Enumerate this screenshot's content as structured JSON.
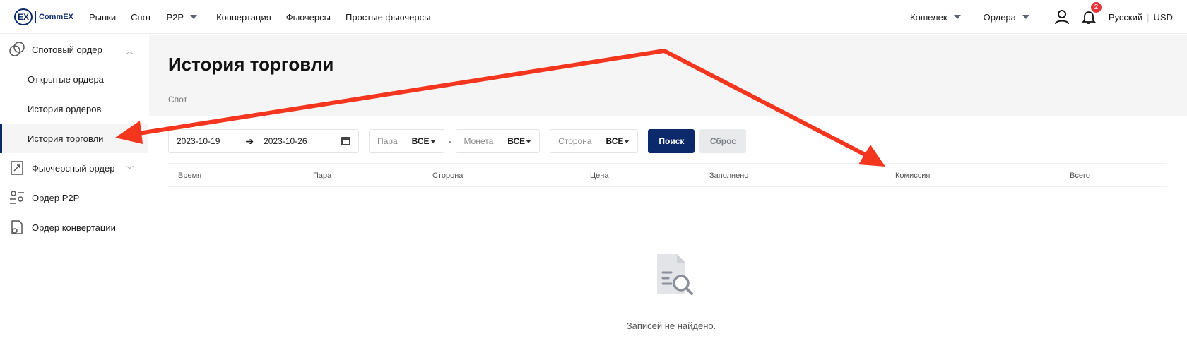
{
  "brand": {
    "mark": "EX",
    "name": "CommEX"
  },
  "nav": [
    {
      "label": "Рынки"
    },
    {
      "label": "Спот"
    },
    {
      "label": "P2P"
    },
    {
      "label": "Конвертация"
    },
    {
      "label": "Фьючерсы"
    },
    {
      "label": "Простые фьючерсы"
    }
  ],
  "header_right": {
    "wallet": "Кошелек",
    "orders": "Ордера",
    "notifications_count": "2",
    "language": "Русский",
    "currency": "USD"
  },
  "sidebar": {
    "spot_group": "Спотовый ордер",
    "spot_items": [
      "Открытые ордера",
      "История ордеров",
      "История торговли"
    ],
    "futures_group": "Фьючерсный ордер",
    "p2p_group": "Ордер P2P",
    "convert_group": "Ордер конвертации"
  },
  "page": {
    "title": "История торговли",
    "breadcrumb": "Спот"
  },
  "filters": {
    "date_from": "2023-10-19",
    "arrow": "➔",
    "date_to": "2023-10-26",
    "pair_label": "Пара",
    "pair_value": "ВСЕ",
    "dash": "-",
    "coin_label": "Монета",
    "coin_value": "ВСЕ",
    "side_label": "Сторона",
    "side_value": "ВСЕ",
    "search_button": "Поиск",
    "reset_button": "Сброс"
  },
  "table": {
    "columns": [
      "Время",
      "Пара",
      "Сторона",
      "Цена",
      "Заполнено",
      "Комиссия",
      "Всего"
    ]
  },
  "empty_state": {
    "text": "Записей не найдено."
  },
  "colors": {
    "brand": "#0b2a6b",
    "badge": "#e5353a",
    "annotation_arrow": "#f4361e"
  }
}
